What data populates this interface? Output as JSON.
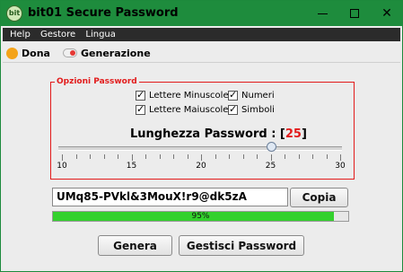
{
  "window": {
    "title": "bit01 Secure Password",
    "icon_text": "bit"
  },
  "menu": {
    "items": [
      "Help",
      "Gestore",
      "Lingua"
    ]
  },
  "toolbar": {
    "dona_label": "Dona",
    "generazione_label": "Generazione"
  },
  "options": {
    "title": "Opzioni Password",
    "checkboxes": [
      {
        "label": "Lettere Minuscole",
        "checked": true
      },
      {
        "label": "Numeri",
        "checked": true
      },
      {
        "label": "Lettere Maiuscole",
        "checked": true
      },
      {
        "label": "Simboli",
        "checked": true
      }
    ]
  },
  "length": {
    "label_prefix": "Lunghezza Password : [",
    "value": "25",
    "label_suffix": "]",
    "min": 10,
    "max": 30,
    "tick_labels": [
      "10",
      "15",
      "20",
      "25",
      "30"
    ]
  },
  "password": {
    "value": "UMq85-PVkl&3MouX!r9@dk5zA"
  },
  "buttons": {
    "copia": "Copia",
    "genera": "Genera",
    "gestisci": "Gestisci Password"
  },
  "progress": {
    "value": 95,
    "text": "95%"
  },
  "colors": {
    "title_bar": "#1e8c3d",
    "options_border": "#e21b1b",
    "progress_fill": "#33d12d"
  },
  "icons": {
    "app": "bit01-logo-icon",
    "dona": "donate-coin-icon",
    "generazione": "toggle-icon"
  }
}
